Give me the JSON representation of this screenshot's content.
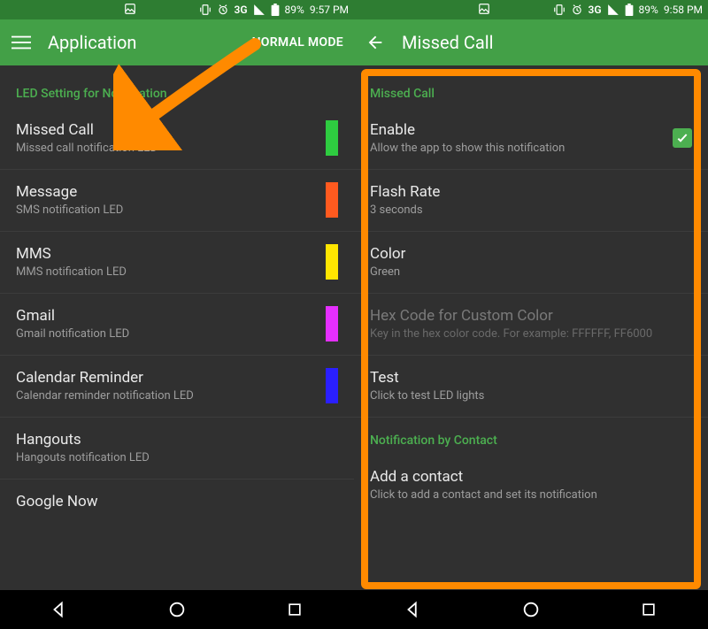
{
  "left": {
    "status": {
      "net": "3G",
      "battery_pct": "89%",
      "time": "9:57 PM"
    },
    "appbar": {
      "title": "Application",
      "mode": "NORMAL MODE"
    },
    "section_header": "LED Setting for Notification",
    "items": [
      {
        "title": "Missed Call",
        "sub": "Missed call notification LED",
        "color": "#2ecc40"
      },
      {
        "title": "Message",
        "sub": "SMS notification LED",
        "color": "#ff5a1f"
      },
      {
        "title": "MMS",
        "sub": "MMS notification LED",
        "color": "#ffe600"
      },
      {
        "title": "Gmail",
        "sub": "Gmail notification LED",
        "color": "#e52fff"
      },
      {
        "title": "Calendar Reminder",
        "sub": "Calendar reminder notification LED",
        "color": "#2a1fff"
      },
      {
        "title": "Hangouts",
        "sub": "Hangouts notification LED",
        "color": ""
      },
      {
        "title": "Google Now",
        "sub": "",
        "color": ""
      }
    ]
  },
  "right": {
    "status": {
      "net": "3G",
      "battery_pct": "89%",
      "time": "9:58 PM"
    },
    "appbar": {
      "title": "Missed Call"
    },
    "section1": "Missed Call",
    "rows": [
      {
        "title": "Enable",
        "sub": "Allow the app to show this notification",
        "checkbox": true
      },
      {
        "title": "Flash Rate",
        "sub": "3 seconds"
      },
      {
        "title": "Color",
        "sub": "Green"
      },
      {
        "title": "Hex Code for Custom Color",
        "sub": "Key in the hex color code. For example: FFFFFF, FF6000",
        "disabled": true
      },
      {
        "title": "Test",
        "sub": "Click to test LED lights"
      }
    ],
    "section2": "Notification by Contact",
    "rows2": [
      {
        "title": "Add a contact",
        "sub": "Click to add a contact and set its notification"
      }
    ]
  }
}
